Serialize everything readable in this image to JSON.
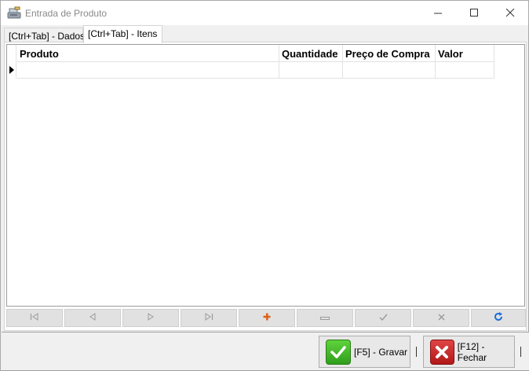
{
  "window": {
    "title": "Entrada de Produto",
    "icon": "cash-register-icon"
  },
  "tabs": [
    {
      "label": "[Ctrl+Tab] - Dados",
      "active": false
    },
    {
      "label": "[Ctrl+Tab] - Itens",
      "active": true
    }
  ],
  "grid": {
    "columns": [
      "Produto",
      "Quantidade",
      "Preço de Compra",
      "Valor"
    ],
    "rows": [
      [
        "",
        "",
        "",
        ""
      ]
    ]
  },
  "navigator": {
    "buttons": [
      {
        "icon": "first-record-icon",
        "glyph": "⏮"
      },
      {
        "icon": "prior-record-icon",
        "glyph": "◁"
      },
      {
        "icon": "next-record-icon",
        "glyph": "▷"
      },
      {
        "icon": "last-record-icon",
        "glyph": "⏭"
      },
      {
        "icon": "insert-icon",
        "glyph": "+"
      },
      {
        "icon": "delete-icon",
        "glyph": "—"
      },
      {
        "icon": "post-icon",
        "glyph": "✓"
      },
      {
        "icon": "cancel-icon",
        "glyph": "✕"
      },
      {
        "icon": "refresh-icon",
        "glyph": "↻"
      }
    ]
  },
  "actions": {
    "save_label": "[F5] - Gravar",
    "close_label": "[F12] - Fechar"
  },
  "colors": {
    "insert": "#d9641c",
    "refresh": "#1e6ed8",
    "save_icon": "#3cb52a",
    "close_icon": "#c62020"
  }
}
